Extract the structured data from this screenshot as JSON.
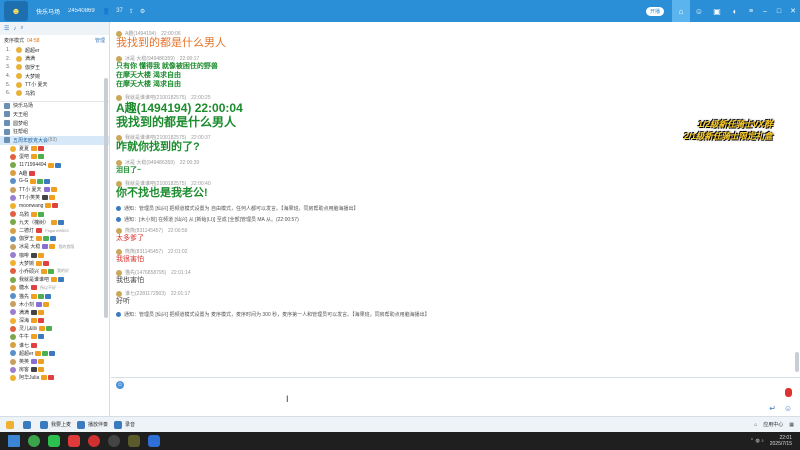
{
  "titlebar": {
    "title": "快乐马场",
    "room_id": "24540869",
    "count": "37",
    "badge": "开播",
    "icons": [
      "user-icon",
      "share-icon",
      "settings-icon"
    ]
  },
  "left": {
    "mode_label": "麦序模式",
    "mode_time": "04:58",
    "manage": "管理",
    "queue": [
      {
        "num": "1.",
        "name": "超超er"
      },
      {
        "num": "2.",
        "name": "满满"
      },
      {
        "num": "3.",
        "name": "伽罗王"
      },
      {
        "num": "4.",
        "name": "大梦婉"
      },
      {
        "num": "5.",
        "name": "TT小 夏天"
      },
      {
        "num": "6.",
        "name": "乌鸦"
      }
    ],
    "channels": [
      {
        "name": "快乐马场"
      },
      {
        "name": "天王组"
      },
      {
        "name": "圆梦组"
      },
      {
        "name": "狂帮组"
      },
      {
        "name": "五周年欧克大会"
      }
    ],
    "channel_count": "(83)",
    "members": [
      {
        "name": "夏夏"
      },
      {
        "name": "蛋吧"
      },
      {
        "name": "1171994494"
      },
      {
        "name": "A趣"
      },
      {
        "name": "G-G"
      },
      {
        "name": "TT小 夏天"
      },
      {
        "name": "TT小笑笑"
      },
      {
        "name": "moonwang"
      },
      {
        "name": "乌鸦"
      },
      {
        "name": "九天（槐树）"
      },
      {
        "name": "二德灯",
        "tag": "Pagani99503"
      },
      {
        "name": "伽罗王"
      },
      {
        "name": "冰是 大稳",
        "tag": "我的首版"
      },
      {
        "name": "咖啡"
      },
      {
        "name": "大梦婉"
      },
      {
        "name": "小乔硕兴",
        "tag": "我的好"
      },
      {
        "name": "我就是谁谁吧"
      },
      {
        "name": "糖水",
        "tag": "所以不好"
      },
      {
        "name": "猫先"
      },
      {
        "name": "木小刻"
      },
      {
        "name": "满满"
      },
      {
        "name": "深海"
      },
      {
        "name": "灵儿&lili"
      },
      {
        "name": "牛牛"
      },
      {
        "name": "谁七"
      },
      {
        "name": "超超er"
      },
      {
        "name": "英英"
      },
      {
        "name": "房客"
      },
      {
        "name": "阿华Julia"
      }
    ]
  },
  "chat": {
    "messages": [
      {
        "meta_name": "A趣(1494194)",
        "time": "22:00:06",
        "lines": [
          "我找到的都是什么男人"
        ],
        "style": "orange",
        "size": 11
      },
      {
        "meta_name": "冰是 大稳(949486359)",
        "time": "22:00:17",
        "lines": [
          "只有你 懂得我 就像被困住的野兽",
          "在摩天大楼 渴求自由",
          "在摩天大楼 渴求自由"
        ],
        "style": "green",
        "size": 7
      },
      {
        "meta_name": "我就是谁谁吧(2100182575)",
        "time": "22:00:25",
        "lines": [
          "A趣(1494194)  22:00:04",
          "我找到的都是什么男人"
        ],
        "style": "green",
        "size": 12
      },
      {
        "meta_name": "我就是谁谁吧(2100182575)",
        "time": "22:00:37",
        "lines": [
          "咋就你找到的了?"
        ],
        "style": "green",
        "size": 11
      },
      {
        "meta_name": "冰是 大稳(949486359)",
        "time": "22:00:39",
        "lines": [
          "泪目了~"
        ],
        "style": "green",
        "size": 7
      },
      {
        "meta_name": "我就是谁谁吧(2100182575)",
        "time": "22:00:40",
        "lines": [
          "你不找也是我老公!"
        ],
        "style": "green",
        "size": 11
      },
      {
        "meta_name": "熊熊(831145457)",
        "time": "22:00:59",
        "lines": [
          "太多爹了"
        ],
        "style": "red",
        "size": 7
      },
      {
        "meta_name": "熊熊(831145457)",
        "time": "22:01:02",
        "lines": [
          "我很害怕"
        ],
        "style": "red",
        "size": 7
      },
      {
        "meta_name": "猫先(1476858795)",
        "time": "22:01:14",
        "lines": [
          "我也害怕"
        ],
        "style": "gray",
        "size": 7
      },
      {
        "meta_name": "谁七(2281172903)",
        "time": "22:01:17",
        "lines": [
          "好听"
        ],
        "style": "gray",
        "size": 7
      }
    ],
    "notices": [
      "通知：管理员 [仙兴] 把频道模式设置为 自由模式，任何人都可以发言。【海果班，同房帮助点用脑海播出】",
      "通知：[木小刻] 在频道 [仙兴] 从 [新蛤(LI)] 至成 [全部]管理员 MA 从。(22:00:57)",
      "通知：管理员 [仙兴] 把频道模式设置为 麦序模式，麦序时间为 300 秒，麦序第一人和管理员可以发言。【海果班，同房帮助点用脑海播出】"
    ]
  },
  "overlay": {
    "line1": "1/2级新任骑士VX群",
    "line2": "2/1级新任骑士限定礼盒"
  },
  "toolbar": {
    "items": [
      "我要上麦",
      "播放伴奏",
      "录音"
    ],
    "right": "应用中心"
  },
  "taskbar": {
    "time": "22:01",
    "date": "2025/7/15"
  }
}
